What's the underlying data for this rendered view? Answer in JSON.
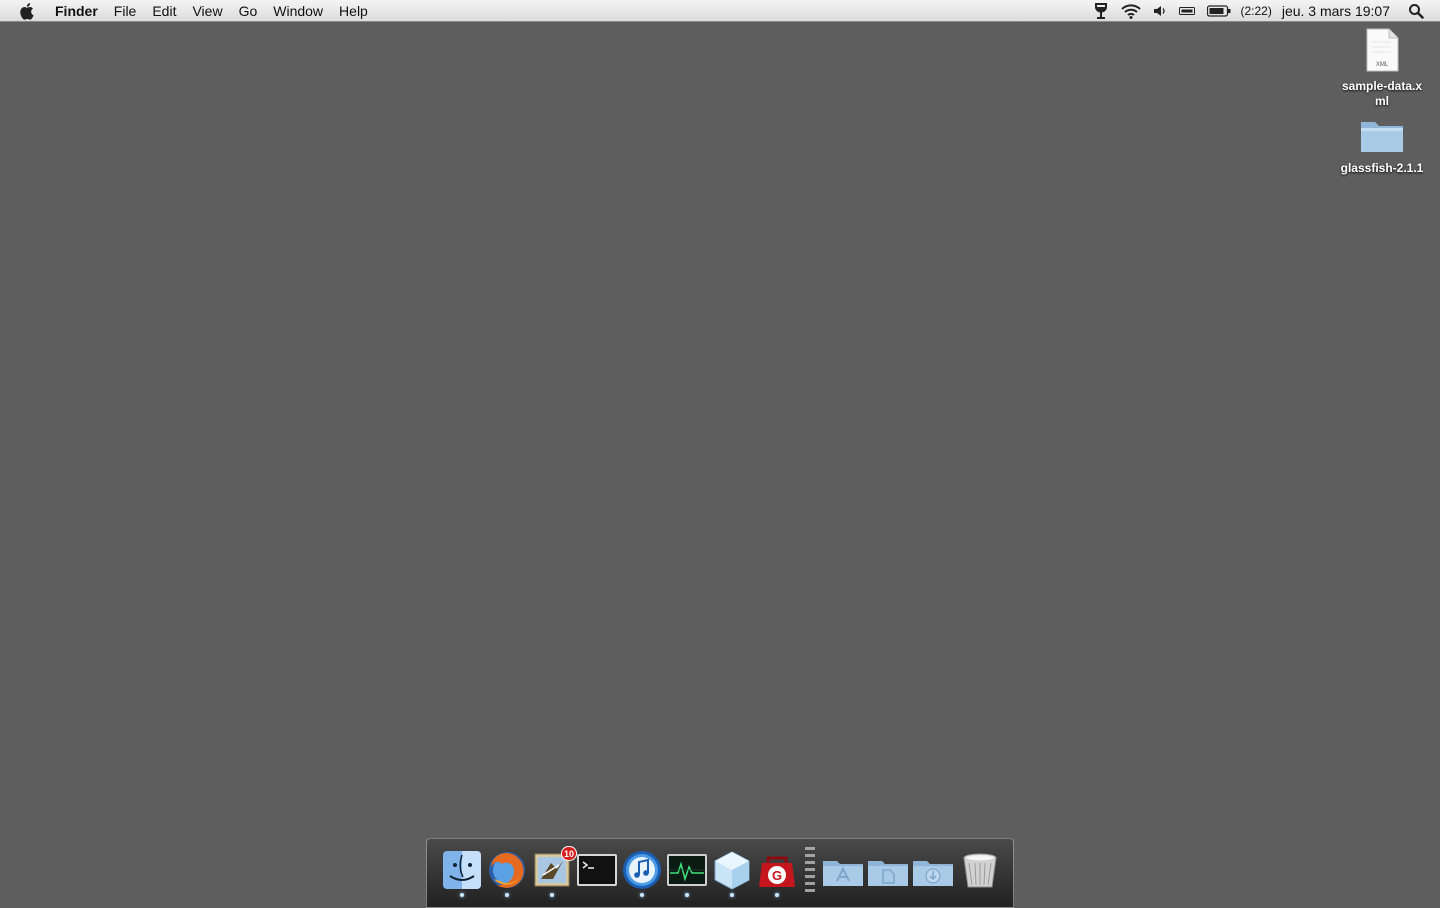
{
  "menubar": {
    "apple_icon": "apple-logo-icon",
    "app_name": "Finder",
    "menus": [
      "File",
      "Edit",
      "View",
      "Go",
      "Window",
      "Help"
    ],
    "status": {
      "icons": [
        "time-machine-icon",
        "wifi-icon",
        "volume-icon",
        "keyboard-icon",
        "battery-icon"
      ],
      "battery_time": "(2:22)",
      "clock": "jeu. 3 mars  19:07",
      "spotlight_icon": "spotlight-search-icon"
    }
  },
  "desktop": {
    "background_color": "#5e5e5e",
    "icons": [
      {
        "label": "sample-data.xml",
        "type": "xml-document-icon",
        "badge_text": "XML"
      },
      {
        "label": "glassfish-2.1.1",
        "type": "folder-icon"
      }
    ]
  },
  "dock": {
    "apps": [
      {
        "name": "finder-icon",
        "running": true
      },
      {
        "name": "firefox-icon",
        "running": true
      },
      {
        "name": "mail-icon",
        "running": true,
        "badge": "10"
      },
      {
        "name": "terminal-icon",
        "running": false
      },
      {
        "name": "itunes-icon",
        "running": true
      },
      {
        "name": "activity-monitor-icon",
        "running": true
      },
      {
        "name": "virtualbox-icon",
        "running": true
      },
      {
        "name": "git-toolbox-icon",
        "running": true
      }
    ],
    "stacks": [
      {
        "name": "applications-stack-icon"
      },
      {
        "name": "documents-stack-icon"
      },
      {
        "name": "downloads-stack-icon"
      }
    ],
    "trash": {
      "name": "trash-icon"
    }
  }
}
